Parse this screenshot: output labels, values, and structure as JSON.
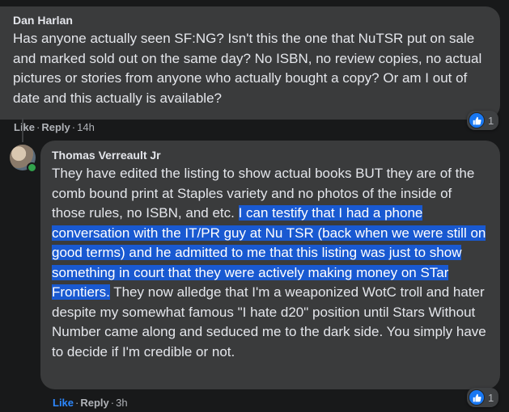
{
  "comments": [
    {
      "author": "Dan Harlan",
      "text": "Has anyone actually seen SF:NG? Isn't this the one that NuTSR put on sale and marked sold out on the same day? No ISBN, no review copies, no actual pictures or stories from anyone who actually bought a copy? Or am I out of date and this actually is available?",
      "actions": {
        "like": "Like",
        "reply": "Reply",
        "time": "14h"
      },
      "reaction_count": "1"
    },
    {
      "author": "Thomas Verreault Jr",
      "text_before": "They have edited the listing to show actual books BUT they are of the comb bound print at Staples variety and no photos of the inside of those rules, no ISBN, and etc.",
      "text_highlight": "I can testify that I had a phone conversation with the IT/PR guy at Nu TSR (back when we were still on good terms) and he admitted to me that this listing was just to show something in court that they were actively making money on STar Frontiers.",
      "text_after": "They now alledge that I'm a weaponized WotC troll and hater despite my somewhat famous \"I hate d20\" position until Stars Without Number came along and seduced me to the dark side. You simply have to decide if I'm credible or not.",
      "actions": {
        "like": "Like",
        "reply": "Reply",
        "time": "3h"
      },
      "reaction_count": "1"
    }
  ],
  "colors": {
    "accent": "#2d88ff",
    "like_blue": "#1877f2",
    "highlight": "#1959d1",
    "bubble": "#3a3b3c",
    "background": "#18191a"
  }
}
